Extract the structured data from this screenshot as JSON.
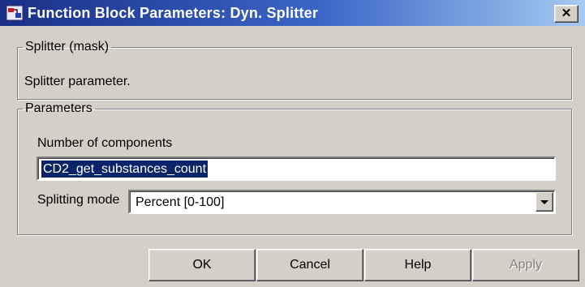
{
  "window": {
    "title": "Function Block Parameters: Dyn. Splitter",
    "close_symbol": "✕",
    "app_icon": "simulink-block-icon"
  },
  "mask_group": {
    "legend": "Splitter (mask)",
    "description": "Splitter parameter."
  },
  "params_group": {
    "legend": "Parameters",
    "num_components_label": "Number of components",
    "num_components_value": "CD2_get_substances_count",
    "splitting_mode_label": "Splitting mode",
    "splitting_mode_value": "Percent [0-100]"
  },
  "buttons": {
    "ok": "OK",
    "cancel": "Cancel",
    "help": "Help",
    "apply": "Apply"
  }
}
